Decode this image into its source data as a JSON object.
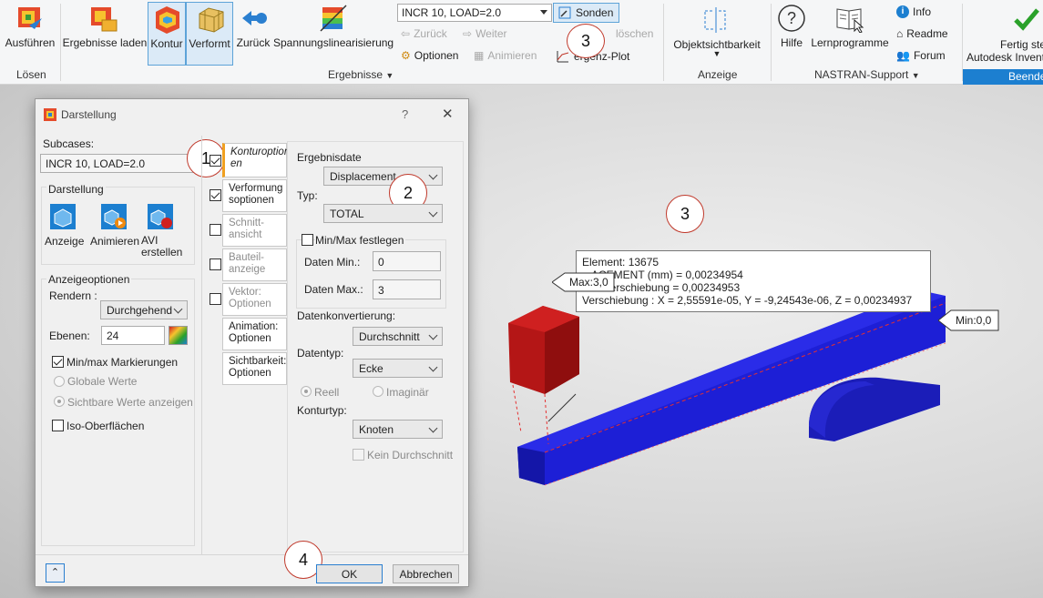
{
  "ribbon": {
    "solve_label": "Ausführen",
    "solve_group": "Lösen",
    "load_results_label": "Ergebnisse laden",
    "contour_label": "Kontur",
    "deformed_label": "Verformt",
    "back_label": "Zurück",
    "stress_lin_label": "Spannungslinearisierung",
    "increment_combo": "INCR 10, LOAD=2.0",
    "probes_label": "Sonden",
    "back_small": "Zurück",
    "forward_small": "Weiter",
    "delete_small": "löschen",
    "options_label": "Optionen",
    "animate_label": "Animieren",
    "convergence_label": "ergenz-Plot",
    "results_group": "Ergebnisse",
    "object_vis_label": "Objektsichtbarkeit",
    "display_group": "Anzeige",
    "help_label": "Hilfe",
    "tutorials_label": "Lernprogramme",
    "info_label": "Info",
    "readme_label": "Readme",
    "forum_label": "Forum",
    "nastran_group": "NASTRAN-Support",
    "finish_label_1": "Fertig ste",
    "finish_label_2": "Autodesk Invent",
    "finish_group": "Beende"
  },
  "callouts": {
    "c1": "1",
    "c2": "2",
    "c3_ribbon": "3",
    "c3_view": "3",
    "c4": "4"
  },
  "dialog": {
    "title": "Darstellung",
    "help_glyph": "?",
    "close_glyph": "✕",
    "subcases_label": "Subcases:",
    "subcase_value": "INCR 10, LOAD=2.0",
    "display_group": "Darstellung",
    "display_btn": "Anzeige",
    "animate_btn": "Animieren",
    "avi_btn_1": "AVI",
    "avi_btn_2": "erstellen",
    "display_options_group": "Anzeigeoptionen",
    "render_label": "Rendern :",
    "render_value": "Durchgehend",
    "levels_label": "Ebenen:",
    "levels_value": "24",
    "minmax_markers": "Min/max Markierungen",
    "global_values": "Globale Werte",
    "visible_values": "Sichtbare Werte anzeigen",
    "iso_surfaces": "Iso-Oberflächen",
    "tabs": [
      {
        "label_1": "Konturoption",
        "label_2": "en"
      },
      {
        "label_1": "Verformung",
        "label_2": "soptionen"
      },
      {
        "label_1": "Schnitt-",
        "label_2": "ansicht"
      },
      {
        "label_1": "Bauteil-",
        "label_2": "anzeige"
      },
      {
        "label_1": "Vektor:",
        "label_2": "Optionen"
      },
      {
        "label_1": "Animation:",
        "label_2": "Optionen"
      },
      {
        "label_1": "Sichtbarkeit:",
        "label_2": "Optionen"
      }
    ],
    "result_file_label": "Ergebnisdate",
    "result_file_value": "Displacement",
    "type_label": "Typ:",
    "type_value": "TOTAL",
    "fix_minmax": "Min/Max festlegen",
    "data_min_label": "Daten Min.:",
    "data_min_value": "0",
    "data_max_label": "Daten Max.:",
    "data_max_value": "3",
    "data_conversion_label": "Datenkonvertierung:",
    "data_conversion_value": "Durchschnitt",
    "datatype_label": "Datentyp:",
    "datatype_value": "Ecke",
    "real_label": "Reell",
    "imag_label": "Imaginär",
    "contour_type_label": "Konturtyp:",
    "contour_type_value": "Knoten",
    "no_average": "Kein Durchschnitt",
    "ok_label": "OK",
    "cancel_label": "Abbrechen"
  },
  "viewport": {
    "max_label": "Max:3,0",
    "min_label": "Min:0,0",
    "tip_line1": "Element: 13675",
    "tip_line2": "...ACEMENT (mm)  = 0,00234954",
    "tip_line3": "...te Verschiebung = 0,00234953",
    "tip_line4": "Verschiebung : X = 2,55591e-05, Y = -9,24543e-06, Z = 0,00234937"
  },
  "colors": {
    "accent_blue": "#1c7fd0",
    "beam_blue": "#1d1fd6",
    "max_red": "#b01010",
    "callout_red": "#c0392b"
  }
}
